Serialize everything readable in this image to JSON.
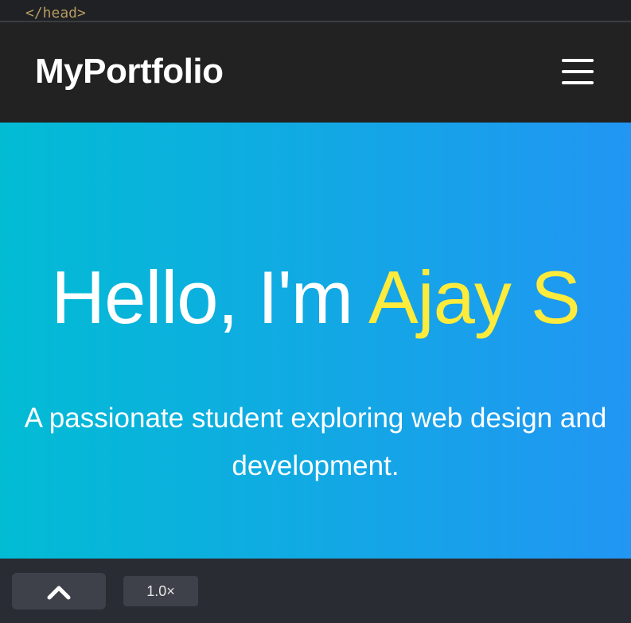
{
  "code_strip": {
    "text": "</head>"
  },
  "navbar": {
    "brand": "MyPortfolio",
    "menu_icon": "hamburger-menu-icon"
  },
  "hero": {
    "greeting": "Hello, I'm ",
    "name": "Ajay S",
    "subtitle": "A passionate student exploring web design and development."
  },
  "bottom_bar": {
    "scroll_icon": "chevron-up-icon",
    "speed_label": "1.0×"
  },
  "colors": {
    "navbar_bg": "#222222",
    "hero_gradient_start": "#02bcd4",
    "hero_gradient_end": "#2196f3",
    "name_highlight": "#ffeb3b",
    "bottom_bar_bg": "#2a2c33"
  }
}
